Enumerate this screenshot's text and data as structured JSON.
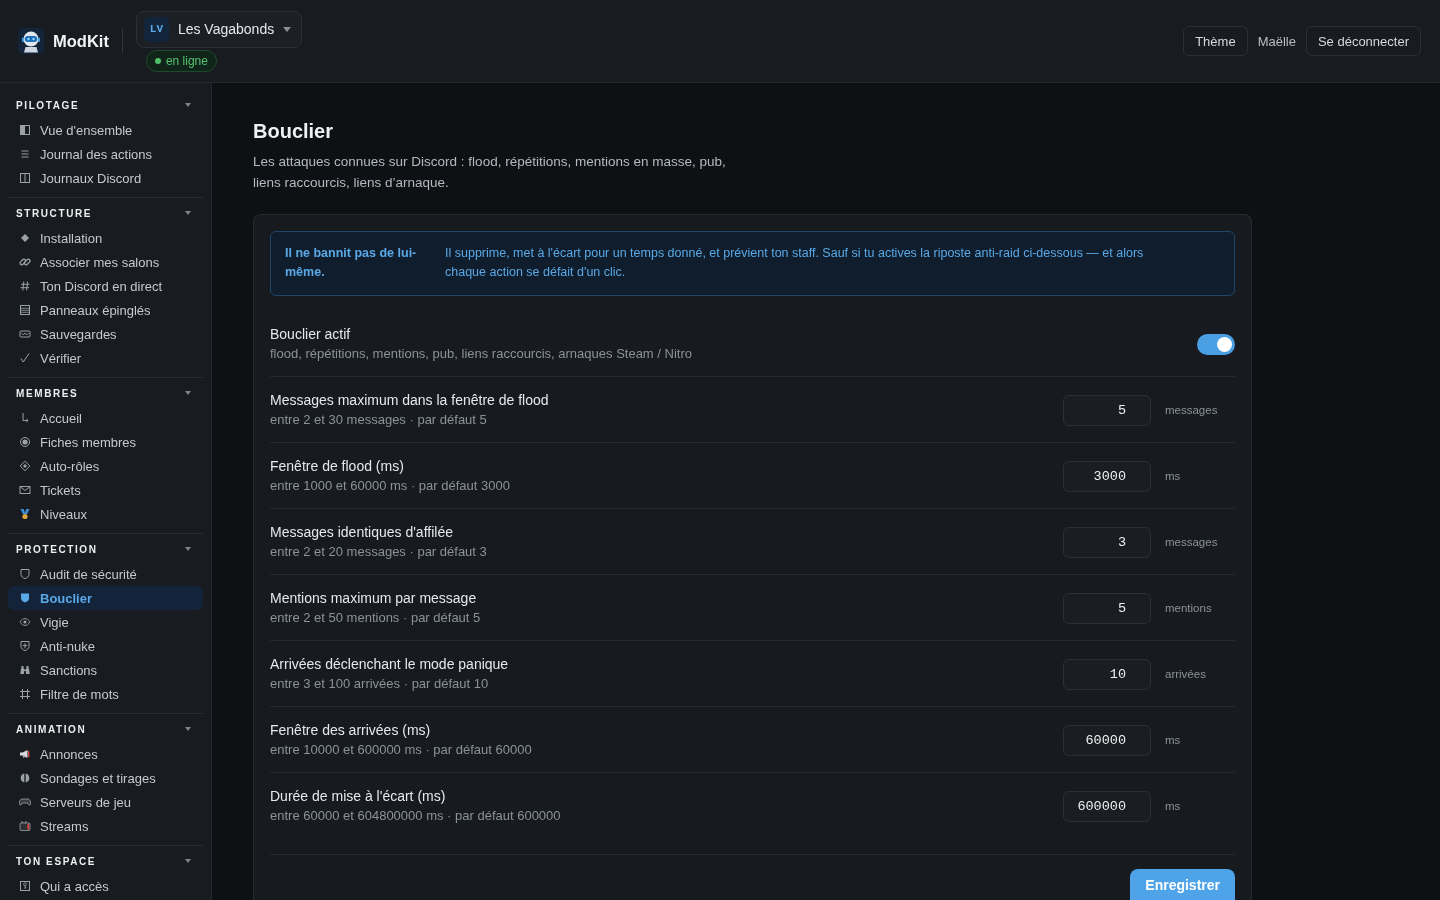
{
  "header": {
    "brand": "ModKit",
    "server": {
      "initials": "LV",
      "name": "Les Vagabonds",
      "status": "en ligne"
    },
    "actions": [
      {
        "kind": "button",
        "label": "Thème"
      },
      {
        "kind": "user",
        "label": "Maëlle"
      },
      {
        "kind": "button",
        "label": "Se déconnecter"
      }
    ]
  },
  "sidebar": {
    "sections": [
      {
        "title": "PILOTAGE",
        "expanded": true,
        "items": [
          {
            "label": "Vue d'ensemble",
            "selected": false
          },
          {
            "label": "Journal des actions",
            "selected": false
          },
          {
            "label": "Journaux Discord",
            "selected": false
          }
        ]
      },
      {
        "title": "STRUCTURE",
        "expanded": true,
        "items": [
          {
            "label": "Installation",
            "selected": false
          },
          {
            "label": "Associer mes salons",
            "selected": false
          },
          {
            "label": "Ton Discord en direct",
            "selected": false
          },
          {
            "label": "Panneaux épinglés",
            "selected": false
          },
          {
            "label": "Sauvegardes",
            "selected": false
          },
          {
            "label": "Vérifier",
            "selected": false
          }
        ]
      },
      {
        "title": "MEMBRES",
        "expanded": true,
        "items": [
          {
            "label": "Accueil",
            "selected": false
          },
          {
            "label": "Fiches membres",
            "selected": false
          },
          {
            "label": "Auto-rôles",
            "selected": false
          },
          {
            "label": "Tickets",
            "selected": false
          },
          {
            "label": "Niveaux",
            "selected": false
          }
        ]
      },
      {
        "title": "PROTECTION",
        "expanded": true,
        "items": [
          {
            "label": "Audit de sécurité",
            "selected": false
          },
          {
            "label": "Bouclier",
            "selected": true
          },
          {
            "label": "Vigie",
            "selected": false
          },
          {
            "label": "Anti-nuke",
            "selected": false
          },
          {
            "label": "Sanctions",
            "selected": false
          },
          {
            "label": "Filtre de mots",
            "selected": false
          }
        ]
      },
      {
        "title": "ANIMATION",
        "expanded": true,
        "items": [
          {
            "label": "Annonces",
            "selected": false
          },
          {
            "label": "Sondages et tirages",
            "selected": false
          },
          {
            "label": "Serveurs de jeu",
            "selected": false
          },
          {
            "label": "Streams",
            "selected": false
          }
        ]
      },
      {
        "title": "TON ESPACE",
        "expanded": true,
        "items": [
          {
            "label": "Qui a accès",
            "selected": false
          }
        ]
      }
    ]
  },
  "page": {
    "title": "Bouclier",
    "description": "Les attaques connues sur Discord : flood, répétitions, mentions en masse, pub, liens raccourcis, liens d’arnaque."
  },
  "notice": {
    "title": "Il ne bannit pas de lui-même.",
    "text": "Il supprime, met à l'écart pour un temps donné, et prévient ton staff. Sauf si tu actives la riposte anti-raid ci-dessous — et alors chaque action se défait d'un clic."
  },
  "settings": [
    {
      "kind": "toggle",
      "label": "Bouclier actif",
      "hint": "flood, répétitions, mentions, pub, liens raccourcis, arnaques Steam / Nitro",
      "on": true
    },
    {
      "kind": "number",
      "label": "Messages maximum dans la fenêtre de flood",
      "hint": "entre 2 et 30 messages · par défaut 5",
      "value": "5",
      "unit": "messages"
    },
    {
      "kind": "number",
      "label": "Fenêtre de flood (ms)",
      "hint": "entre 1000 et 60000 ms · par défaut 3000",
      "value": "3000",
      "unit": "ms"
    },
    {
      "kind": "number",
      "label": "Messages identiques d'affilée",
      "hint": "entre 2 et 20 messages · par défaut 3",
      "value": "3",
      "unit": "messages"
    },
    {
      "kind": "number",
      "label": "Mentions maximum par message",
      "hint": "entre 2 et 50 mentions · par défaut 5",
      "value": "5",
      "unit": "mentions"
    },
    {
      "kind": "number",
      "label": "Arrivées déclenchant le mode panique",
      "hint": "entre 3 et 100 arrivées · par défaut 10",
      "value": "10",
      "unit": "arrivées"
    },
    {
      "kind": "number",
      "label": "Fenêtre des arrivées (ms)",
      "hint": "entre 10000 et 600000 ms · par défaut 60000",
      "value": "60000",
      "unit": "ms"
    },
    {
      "kind": "number",
      "label": "Durée de mise à l'écart (ms)",
      "hint": "entre 60000 et 604800000 ms · par défaut 600000",
      "value": "600000",
      "unit": "ms"
    }
  ],
  "save_button": "Enregistrer"
}
